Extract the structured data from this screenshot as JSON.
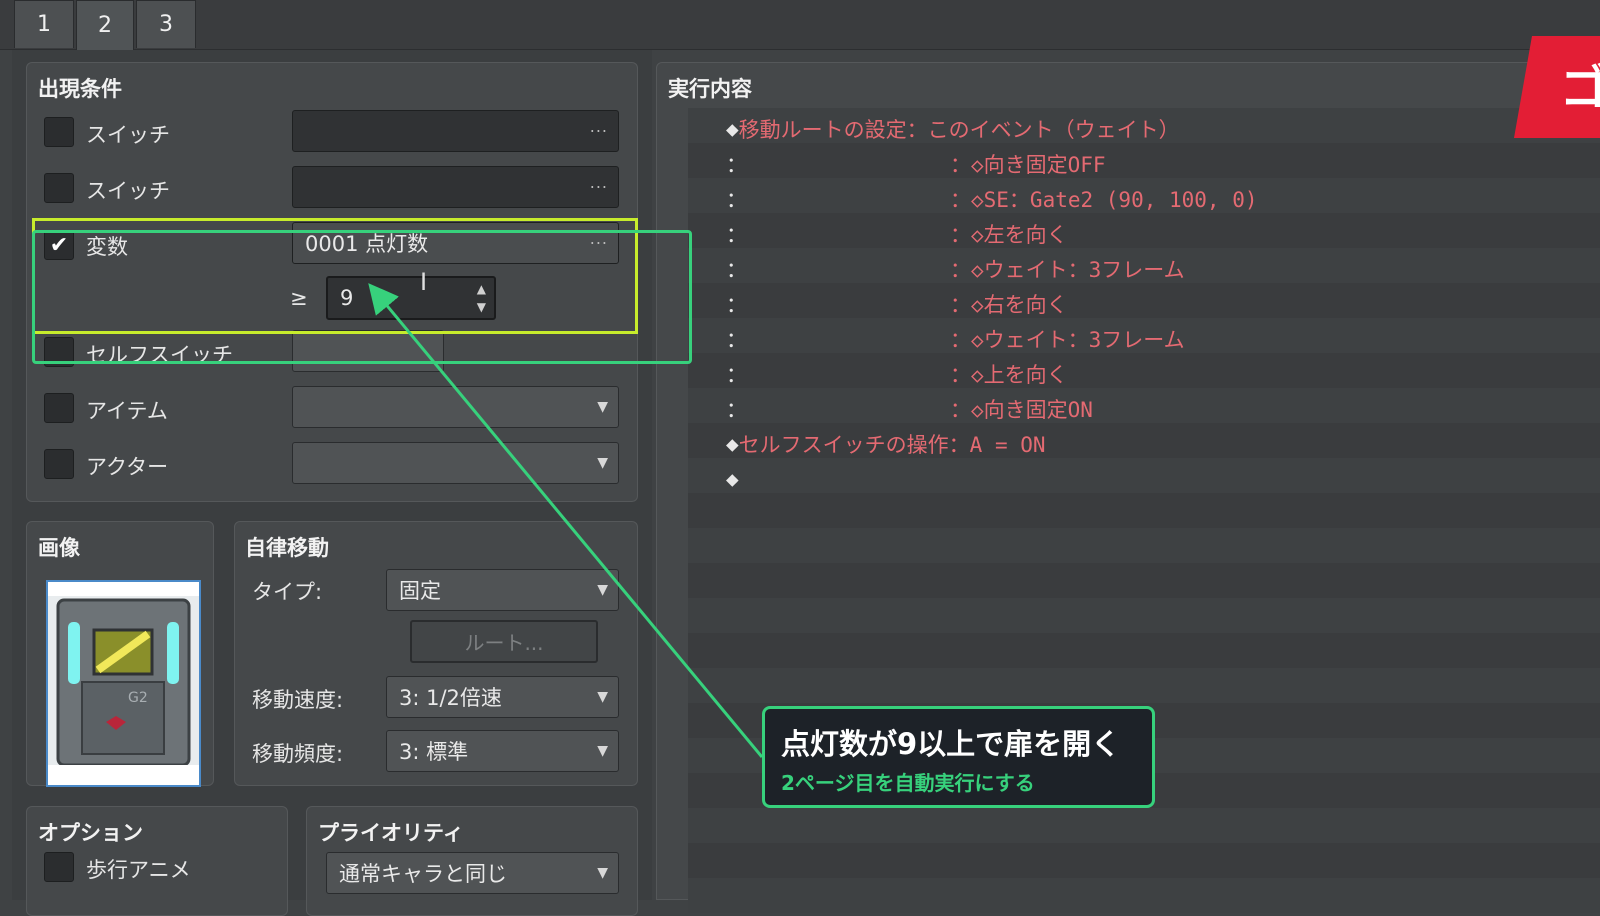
{
  "tabs": [
    "1",
    "2",
    "3"
  ],
  "active_tab": "2",
  "conditions": {
    "title": "出現条件",
    "switch1": {
      "label": "スイッチ",
      "checked": false,
      "value": "",
      "button": "···"
    },
    "switch2": {
      "label": "スイッチ",
      "checked": false,
      "value": "",
      "button": "···"
    },
    "variable": {
      "label": "変数",
      "checked": true,
      "value": "0001 点灯数",
      "button": "···",
      "operator": "≥",
      "threshold": "9"
    },
    "self_switch": {
      "label": "セルフスイッチ",
      "checked": false
    },
    "item": {
      "label": "アイテム",
      "checked": false,
      "value": ""
    },
    "actor": {
      "label": "アクター",
      "checked": false,
      "value": ""
    }
  },
  "image": {
    "title": "画像",
    "sprite_text": "G2"
  },
  "autonomous": {
    "title": "自律移動",
    "type_label": "タイプ:",
    "type_value": "固定",
    "route_button": "ルート...",
    "speed_label": "移動速度:",
    "speed_value": "3: 1/2倍速",
    "freq_label": "移動頻度:",
    "freq_value": "3: 標準"
  },
  "options": {
    "title": "オプション",
    "walk_anim": "歩行アニメ"
  },
  "priority": {
    "title": "プライオリティ",
    "value": "通常キャラと同じ"
  },
  "contents": {
    "title": "実行内容",
    "lines": [
      {
        "prefix": "◆",
        "text": "移動ルートの設定：このイベント（ウェイト）"
      },
      {
        "prefix": "：",
        "text": "：◇向き固定OFF"
      },
      {
        "prefix": "：",
        "text": "：◇SE：Gate2 (90, 100, 0)"
      },
      {
        "prefix": "：",
        "text": "：◇左を向く"
      },
      {
        "prefix": "：",
        "text": "：◇ウェイト：3フレーム"
      },
      {
        "prefix": "：",
        "text": "：◇右を向く"
      },
      {
        "prefix": "：",
        "text": "：◇ウェイト：3フレーム"
      },
      {
        "prefix": "：",
        "text": "：◇上を向く"
      },
      {
        "prefix": "：",
        "text": "：◇向き固定ON"
      },
      {
        "prefix": "◆",
        "text": "セルフスイッチの操作：A = ON"
      },
      {
        "prefix": "◆",
        "text": ""
      }
    ]
  },
  "callout": {
    "main": "点灯数が9以上で扉を開く",
    "sub": "2ページ目を自動実行にする"
  },
  "logo_text": "ゴ",
  "colors": {
    "annotation_green": "#37d17c",
    "annotation_yellow": "#c7ec2c",
    "event_text": "#e46a72",
    "logo_red": "#e31e35"
  }
}
